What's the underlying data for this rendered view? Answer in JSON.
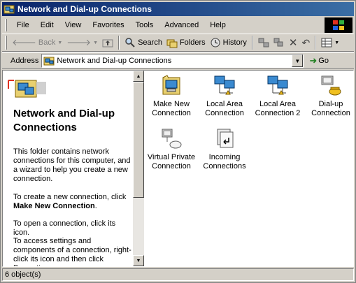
{
  "window": {
    "title": "Network and Dial-up Connections"
  },
  "menu": [
    "File",
    "Edit",
    "View",
    "Favorites",
    "Tools",
    "Advanced",
    "Help"
  ],
  "toolbar": {
    "back": "Back",
    "search": "Search",
    "folders": "Folders",
    "history": "History"
  },
  "address": {
    "label": "Address",
    "value": "Network and Dial-up Connections",
    "go": "Go"
  },
  "left_pane": {
    "heading": "Network and Dial-up Connections",
    "intro": "This folder contains network connections for this computer, and a wizard to help you create a new connection.",
    "create_prefix": "To create a new connection, click",
    "create_link": "Make New Connection",
    "create_suffix": ".",
    "open_text": "To open a connection, click its icon.",
    "access_text": "To access settings and components of a connection, right-click its icon and then click Properties."
  },
  "items": [
    {
      "label": "Make New Connection",
      "icon": "make-new-connection-icon"
    },
    {
      "label": "Local Area Connection",
      "icon": "local-area-connection-icon"
    },
    {
      "label": "Local Area Connection 2",
      "icon": "local-area-connection-icon"
    },
    {
      "label": "Dial-up Connection",
      "icon": "dial-up-connection-icon"
    },
    {
      "label": "Virtual Private Connection",
      "icon": "vpn-connection-icon"
    },
    {
      "label": "Incoming Connections",
      "icon": "incoming-connections-icon"
    }
  ],
  "status": {
    "text": "6 object(s)"
  },
  "colors": {
    "title_start": "#0a246a",
    "title_end": "#3a6ea5",
    "chrome": "#d4d0c8"
  }
}
